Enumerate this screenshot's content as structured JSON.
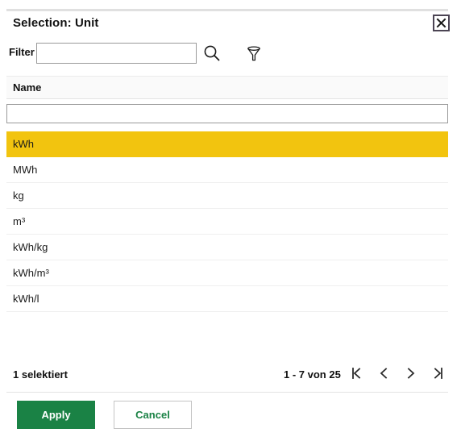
{
  "dialog": {
    "title": "Selection: Unit",
    "close_icon": "close-icon"
  },
  "filter": {
    "label": "Filter",
    "value": "",
    "placeholder": "",
    "search_icon": "search-icon",
    "funnel_icon": "filter-funnel-icon"
  },
  "table": {
    "columns": [
      "Name"
    ],
    "column_filter": {
      "value": "",
      "placeholder": ""
    },
    "rows": [
      {
        "name": "kWh",
        "selected": true
      },
      {
        "name": "MWh",
        "selected": false
      },
      {
        "name": "kg",
        "selected": false
      },
      {
        "name": "m³",
        "selected": false
      },
      {
        "name": "kWh/kg",
        "selected": false
      },
      {
        "name": "kWh/m³",
        "selected": false
      },
      {
        "name": "kWh/l",
        "selected": false
      }
    ]
  },
  "footer": {
    "selected_count": "1 selektiert",
    "page_range": "1 - 7 von 25",
    "pager": {
      "first_icon": "page-first-icon",
      "prev_icon": "page-prev-icon",
      "next_icon": "page-next-icon",
      "last_icon": "page-last-icon"
    }
  },
  "actions": {
    "apply_label": "Apply",
    "cancel_label": "Cancel"
  },
  "colors": {
    "selected_row": "#f2c40f",
    "primary_green": "#1a8245",
    "header_bg": "#fafafa",
    "border": "#9a9a9a"
  }
}
